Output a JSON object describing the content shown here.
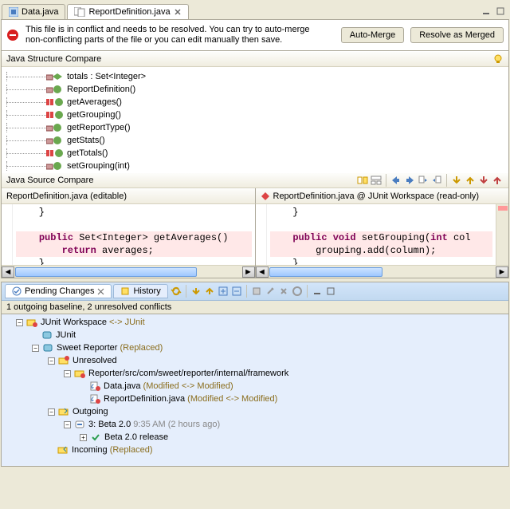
{
  "tabs": {
    "data": "Data.java",
    "report": "ReportDefinition.java"
  },
  "conflict": {
    "message1": "This file is in conflict and needs to be resolved. You can try to auto-merge",
    "message2": "non-conflicting parts of the file or you can edit manually then save.",
    "automerge": "Auto-Merge",
    "resolve": "Resolve as Merged"
  },
  "structure": {
    "title": "Java Structure Compare",
    "items": [
      "totals : Set<Integer>",
      "ReportDefinition()",
      "getAverages()",
      "getGrouping()",
      "getReportType()",
      "getStats()",
      "getTotals()",
      "setGrouping(int)"
    ]
  },
  "source": {
    "title": "Java Source Compare",
    "left_header": "ReportDefinition.java  (editable)",
    "right_header": "ReportDefinition.java @ JUnit Workspace (read-only)",
    "left": {
      "l1": "    }",
      "l2": "",
      "l3_pre": "    ",
      "l3_kw1": "public",
      "l3_mid": " Set<Integer> getAverages()",
      "l4_pre": "        ",
      "l4_kw": "return",
      "l4_post": " averages;",
      "l5": "    }"
    },
    "right": {
      "l1": "    }",
      "l2": "",
      "l3_pre": "    ",
      "l3_kw1": "public",
      "l3_kw2": "void",
      "l3_mid1": " ",
      "l3_mid2": " setGrouping(",
      "l3_kw3": "int",
      "l3_post": " col",
      "l4": "        grouping.add(column);",
      "l5": "    }"
    }
  },
  "pending": {
    "tab1": "Pending Changes",
    "tab2": "History",
    "status": "1 outgoing baseline, 2 unresolved conflicts",
    "t": {
      "ws": "JUnit Workspace",
      "ws_arrow": " <-> ",
      "ws_r": "JUnit",
      "junit": "JUnit",
      "sweet": "Sweet Reporter",
      "replaced": " (Replaced)",
      "unresolved": "Unresolved",
      "path": "Reporter/src/com/sweet/reporter/internal/framework",
      "data": "Data.java",
      "mod": " (Modified <-> Modified)",
      "report": "ReportDefinition.java",
      "outgoing": "Outgoing",
      "baseline": "3: Beta 2.0",
      "time": "  9:35 AM (2 hours ago)",
      "rel": "Beta 2.0 release",
      "incoming": "Incoming"
    }
  }
}
